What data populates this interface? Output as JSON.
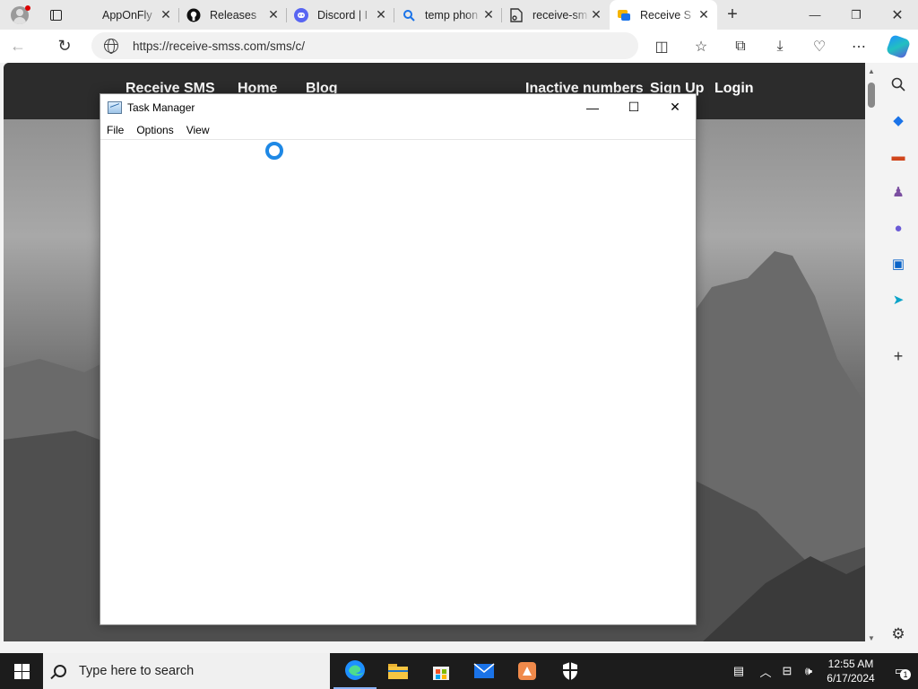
{
  "browser": {
    "tabs": [
      {
        "title": "AppOnFly",
        "icon": "apponfly-icon"
      },
      {
        "title": "Releases",
        "icon": "github-icon"
      },
      {
        "title": "Discord | I",
        "icon": "discord-icon"
      },
      {
        "title": "temp phon",
        "icon": "search-icon"
      },
      {
        "title": "receive-sm",
        "icon": "page-icon"
      },
      {
        "title": "Receive S",
        "icon": "receive-sms-icon",
        "active": true
      }
    ],
    "url": "https://receive-smss.com/sms/c/"
  },
  "site": {
    "nav_left": [
      "Receive SMS",
      "Home",
      "Blog"
    ],
    "nav_right": [
      "Inactive numbers",
      "Sign Up",
      "Login"
    ]
  },
  "task_manager": {
    "title": "Task Manager",
    "menu": [
      "File",
      "Options",
      "View"
    ]
  },
  "taskbar": {
    "search_placeholder": "Type here to search",
    "time": "12:55 AM",
    "date": "6/17/2024",
    "notification_count": "1"
  }
}
